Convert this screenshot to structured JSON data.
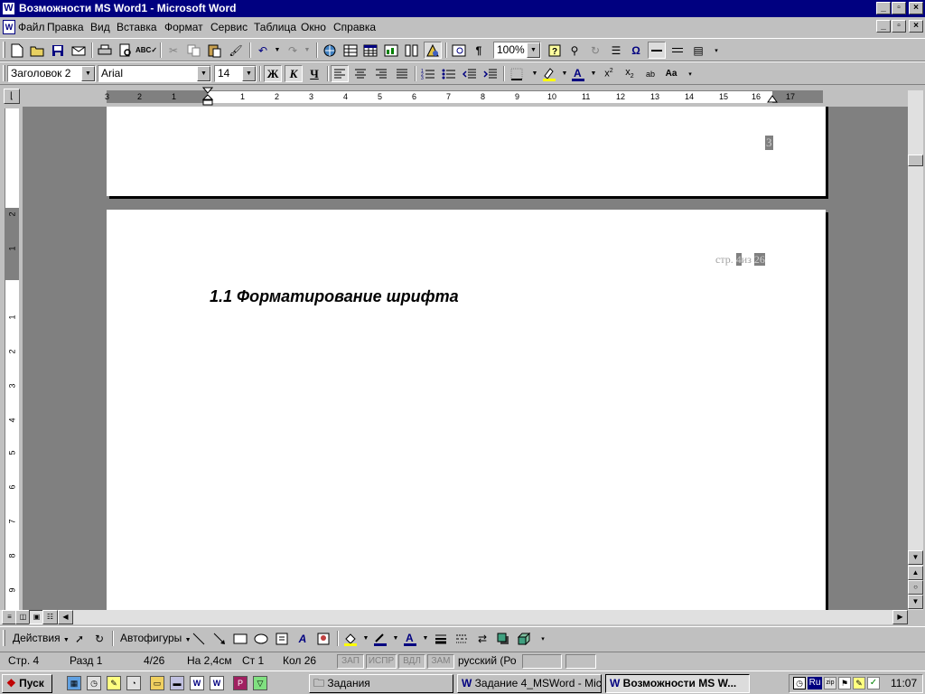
{
  "window": {
    "title": "Возможности MS Word1 - Microsoft Word",
    "controls": [
      "_",
      "▫",
      "×"
    ]
  },
  "menu": {
    "items": [
      "Файл",
      "Правка",
      "Вид",
      "Вставка",
      "Формат",
      "Сервис",
      "Таблица",
      "Окно",
      "Справка"
    ],
    "doc_controls": [
      "_",
      "▫",
      "×"
    ]
  },
  "standard_toolbar": {
    "zoom": "100%"
  },
  "formatting_toolbar": {
    "style": "Заголовок 2",
    "font": "Arial",
    "size": "14",
    "bold": "Ж",
    "italic": "К",
    "underline": "Ч"
  },
  "rulers": {
    "horizontal_numbers": [
      "3",
      "2",
      "1",
      "1",
      "2",
      "3",
      "4",
      "5",
      "6",
      "7",
      "8",
      "9",
      "10",
      "11",
      "12",
      "13",
      "14",
      "15",
      "16",
      "17"
    ],
    "vertical_numbers": [
      "2",
      "1",
      "1",
      "2",
      "3",
      "4",
      "5",
      "6",
      "7",
      "8",
      "9"
    ]
  },
  "document": {
    "prev_page_number": "3",
    "header_prefix": "стр.",
    "header_page": "4",
    "header_of": "из",
    "header_total": "26",
    "heading": "1.1 Форматирование шрифта"
  },
  "drawing_toolbar": {
    "actions": "Действия",
    "autoshapes": "Автофигуры"
  },
  "status": {
    "page": "Стр. 4",
    "section": "Разд 1",
    "pages": "4/26",
    "at": "На 2,4см",
    "line": "Ст 1",
    "col": "Кол 26",
    "rec": "ЗАП",
    "trk": "ИСПР",
    "ext": "ВДЛ",
    "ovr": "ЗАМ",
    "language": "русский (Ро"
  },
  "taskbar": {
    "start": "Пуск",
    "tasks": [
      "Задания",
      "Задание 4_MSWord - Mic...",
      "Возможности MS W..."
    ],
    "clock": "11:07",
    "lang_indicator": "Ru"
  },
  "colors": {
    "titlebar": "#000080",
    "face": "#c0c0c0",
    "workspace": "#808080"
  }
}
